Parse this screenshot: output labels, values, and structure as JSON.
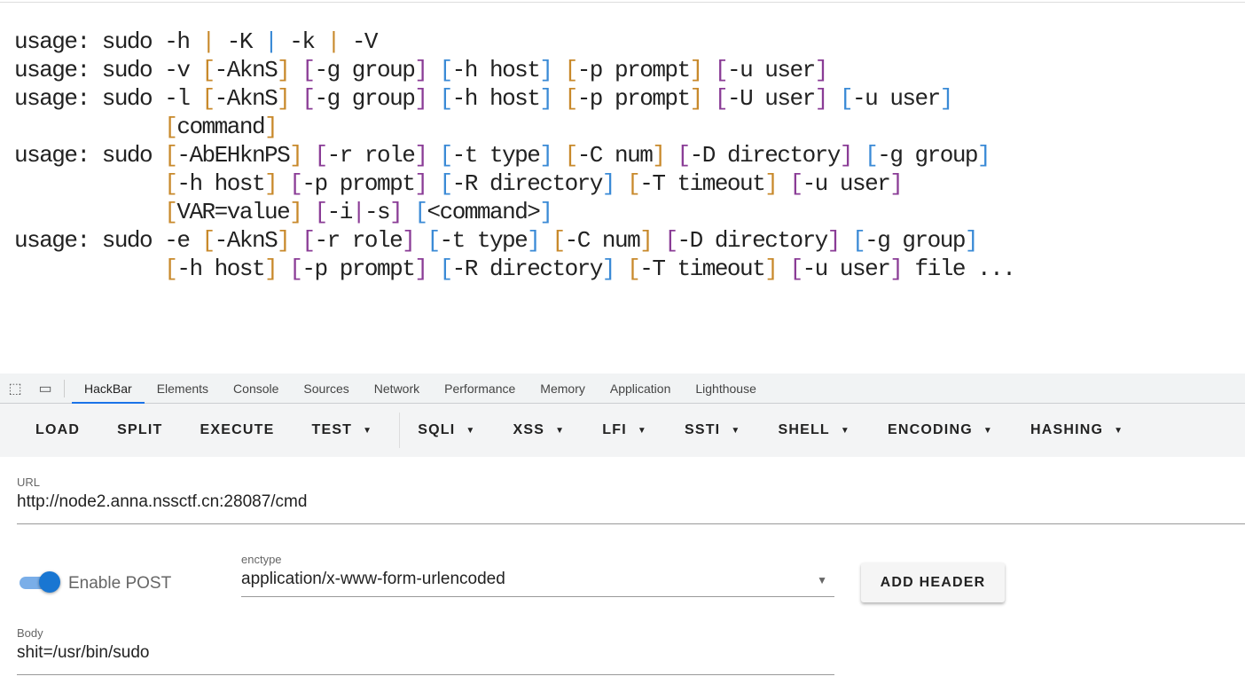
{
  "output": {
    "lines": [
      "usage: sudo -h | -K | -k | -V",
      "usage: sudo -v [-AknS] [-g group] [-h host] [-p prompt] [-u user]",
      "usage: sudo -l [-AknS] [-g group] [-h host] [-p prompt] [-U user] [-u user]",
      "            [command]",
      "usage: sudo [-AbEHknPS] [-r role] [-t type] [-C num] [-D directory] [-g group]",
      "            [-h host] [-p prompt] [-R directory] [-T timeout] [-u user]",
      "            [VAR=value] [-i|-s] [<command>]",
      "usage: sudo -e [-AknS] [-r role] [-t type] [-C num] [-D directory] [-g group]",
      "            [-h host] [-p prompt] [-R directory] [-T timeout] [-u user] file ..."
    ],
    "bracket_colors": [
      "#c8892b",
      "#8a3c96",
      "#3a8ad6"
    ]
  },
  "devtools": {
    "tabs": [
      "HackBar",
      "Elements",
      "Console",
      "Sources",
      "Network",
      "Performance",
      "Memory",
      "Application",
      "Lighthouse"
    ],
    "active": "HackBar"
  },
  "toolbar": {
    "buttons": [
      "LOAD",
      "SPLIT",
      "EXECUTE"
    ],
    "dropdowns": [
      "TEST",
      "SQLI",
      "XSS",
      "LFI",
      "SSTI",
      "SHELL",
      "ENCODING",
      "HASHING"
    ]
  },
  "url": {
    "label": "URL",
    "value": "http://node2.anna.nssctf.cn:28087/cmd"
  },
  "post": {
    "label": "Enable POST",
    "enabled": true
  },
  "enctype": {
    "label": "enctype",
    "value": "application/x-www-form-urlencoded"
  },
  "add_header": "ADD HEADER",
  "body": {
    "label": "Body",
    "value": "shit=/usr/bin/sudo"
  },
  "accent": "#1a73e8"
}
